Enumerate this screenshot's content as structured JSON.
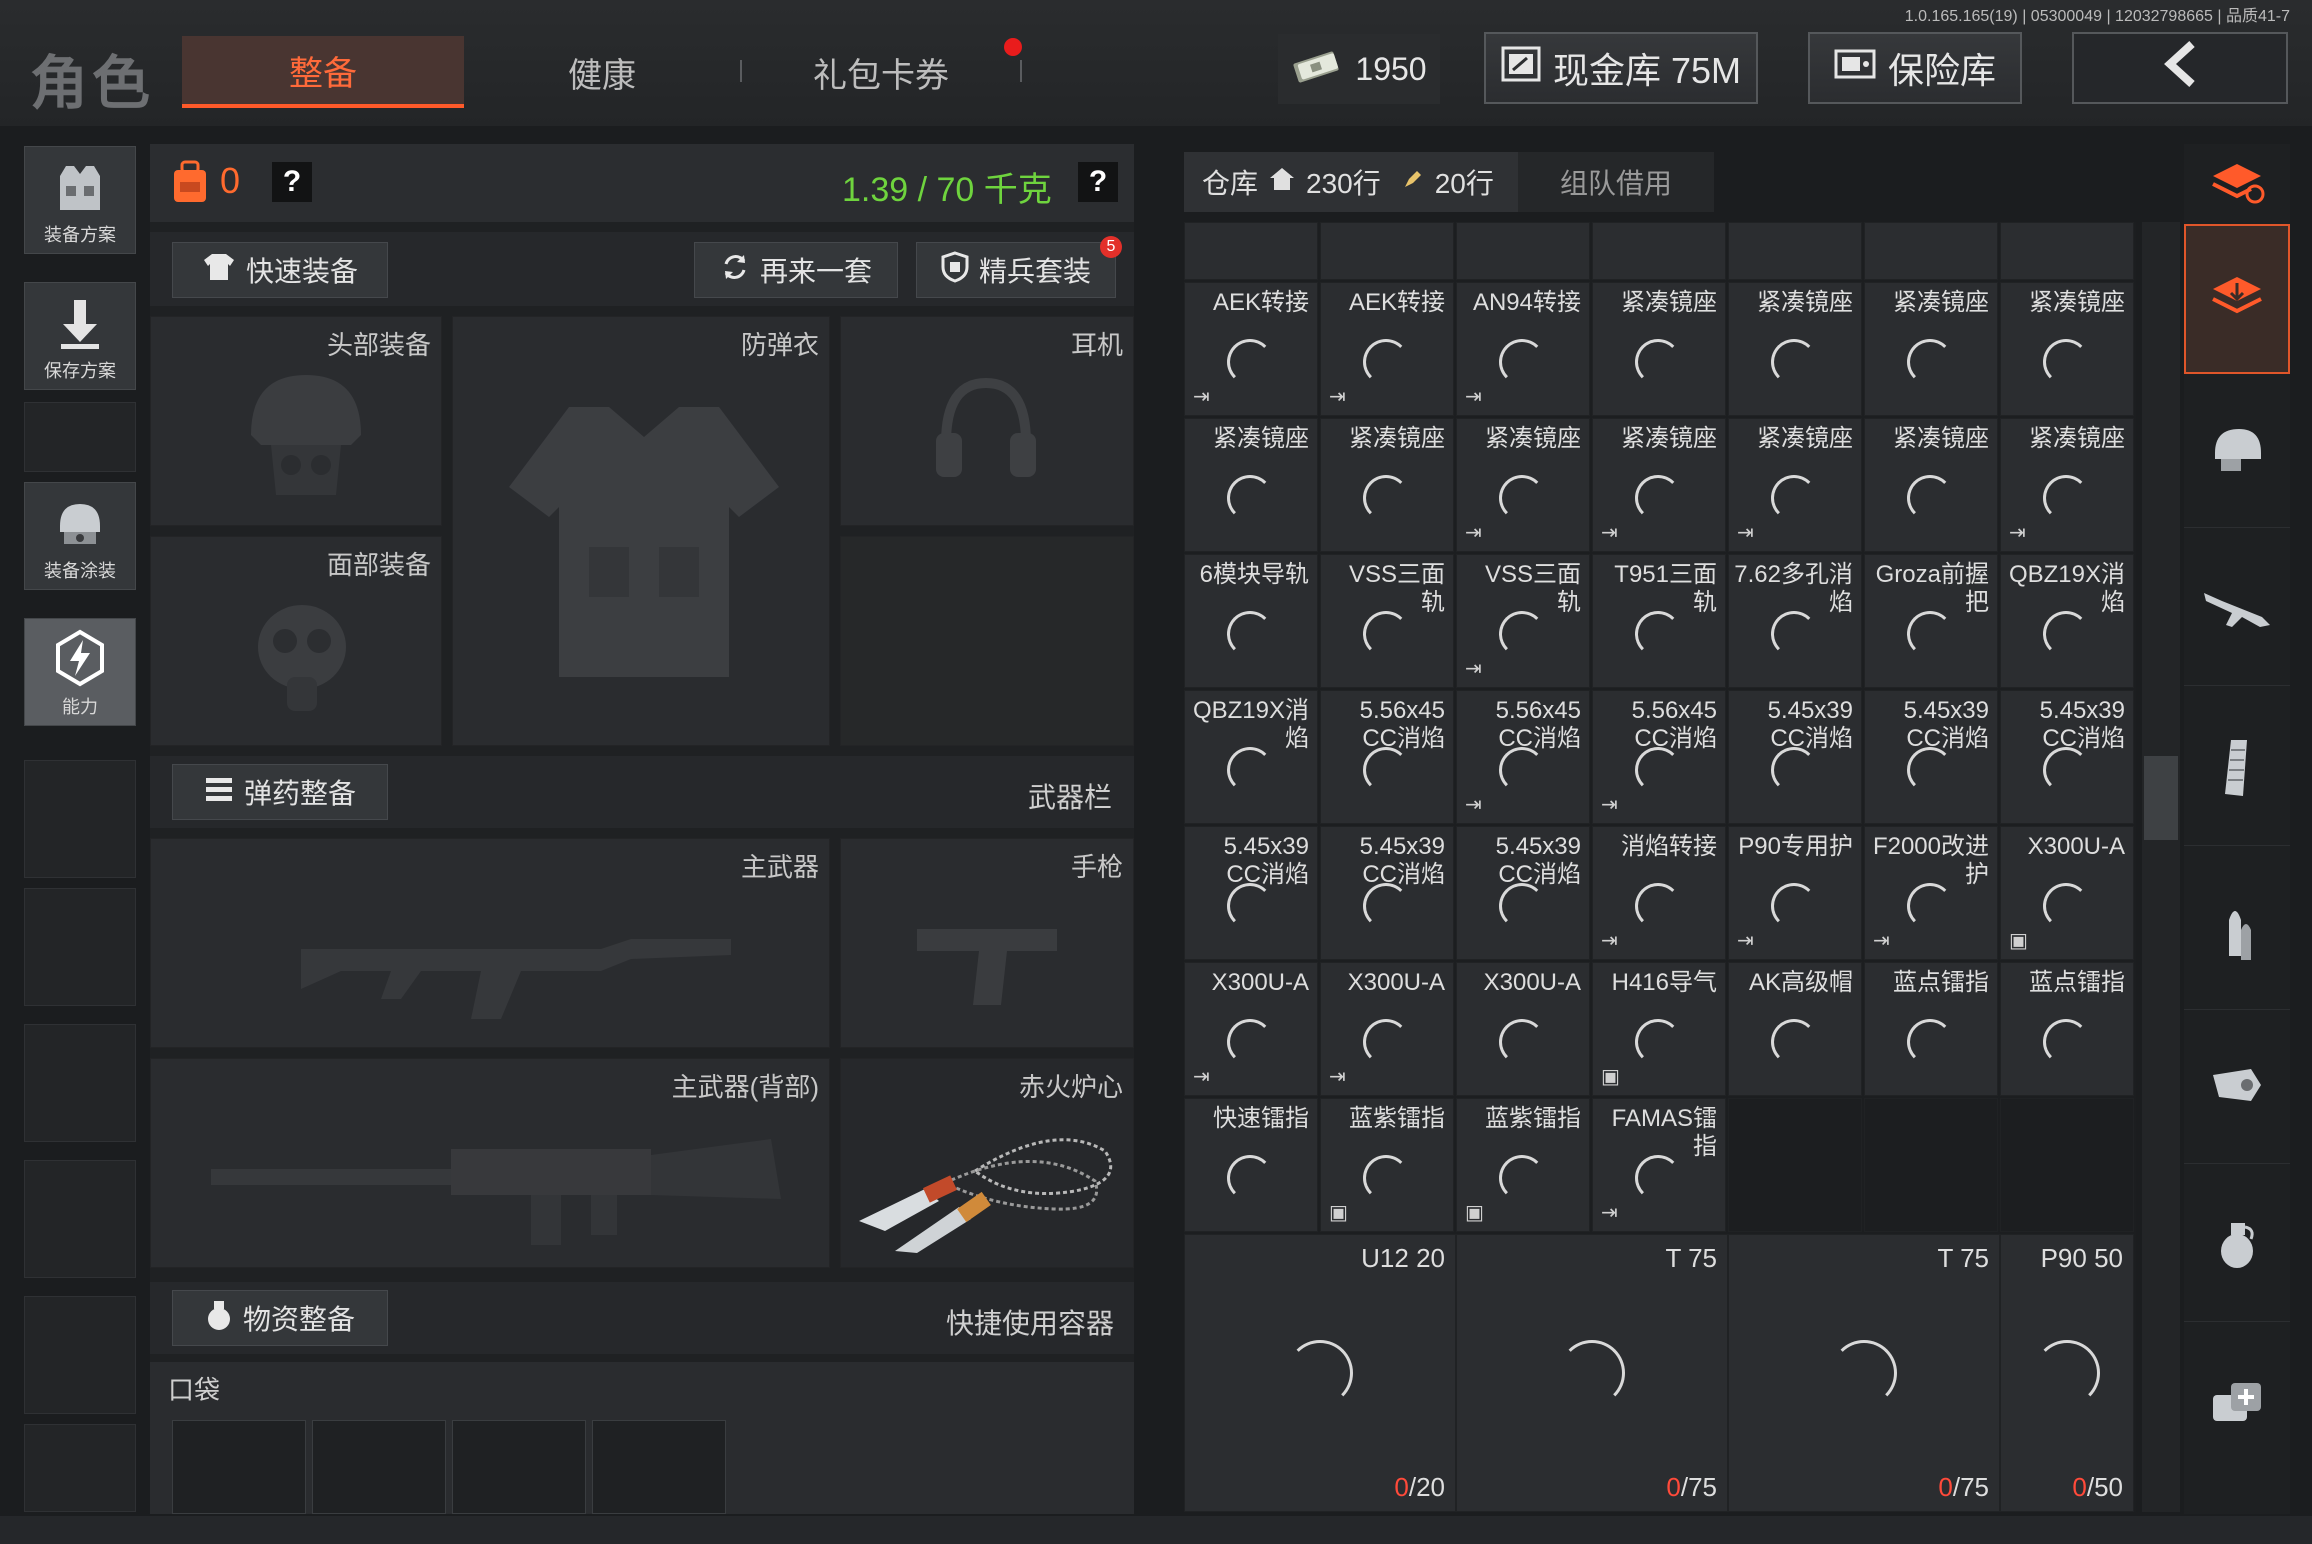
{
  "version": "1.0.165.165(19) | 05300049 | 12032798665 | 品质41-7",
  "header": {
    "title": "角色",
    "tabs": [
      {
        "label": "整备",
        "active": true
      },
      {
        "label": "健康",
        "active": false
      },
      {
        "label": "礼包卡券",
        "active": false
      }
    ],
    "currency": {
      "icon": "cash-bundle-icon",
      "value": "1950"
    },
    "cash_vault": "现金库 75M",
    "safe": "保险库"
  },
  "left_rail": [
    {
      "label": "装备方案",
      "icon": "vest-plan-icon"
    },
    {
      "label": "保存方案",
      "icon": "download-arrow-icon"
    },
    {
      "label": "装备涂装",
      "icon": "helmet-paint-icon"
    },
    {
      "label": "能力",
      "icon": "lightning-hexagon-icon",
      "active": true
    }
  ],
  "equip": {
    "bag_count": "0",
    "help": "?",
    "weight": "1.39 / 70 千克",
    "quick_equip": "快速装备",
    "again": "再来一套",
    "elite": "精兵套装",
    "elite_badge": "5",
    "slots": {
      "head": "头部装备",
      "armor": "防弹衣",
      "ear": "耳机",
      "face": "面部装备"
    },
    "ammo_section": "弹药整备",
    "weapon_bar": "武器栏",
    "weapons": {
      "primary": "主武器",
      "pistol": "手枪",
      "primary_back": "主武器(背部)",
      "melee": "赤火炉心"
    },
    "supply_section": "物资整备",
    "quick_container": "快捷使用容器",
    "pocket": "口袋"
  },
  "warehouse": {
    "tab": "仓库",
    "rows": "230行",
    "cols": "20行",
    "borrow": "组队借用",
    "items": [
      {
        "name": "AEK转接",
        "tag": "exit"
      },
      {
        "name": "AEK转接",
        "tag": "exit"
      },
      {
        "name": "AN94转接",
        "tag": "exit"
      },
      {
        "name": "紧凑镜座",
        "tag": ""
      },
      {
        "name": "紧凑镜座",
        "tag": ""
      },
      {
        "name": "紧凑镜座",
        "tag": ""
      },
      {
        "name": "紧凑镜座",
        "tag": ""
      },
      {
        "name": "紧凑镜座",
        "tag": ""
      },
      {
        "name": "紧凑镜座",
        "tag": ""
      },
      {
        "name": "紧凑镜座",
        "tag": "exit"
      },
      {
        "name": "紧凑镜座",
        "tag": "exit"
      },
      {
        "name": "紧凑镜座",
        "tag": "exit"
      },
      {
        "name": "紧凑镜座",
        "tag": ""
      },
      {
        "name": "紧凑镜座",
        "tag": "exit"
      },
      {
        "name": "6模块导轨",
        "tag": ""
      },
      {
        "name": "VSS三面轨",
        "tag": ""
      },
      {
        "name": "VSS三面轨",
        "tag": "exit"
      },
      {
        "name": "T951三面轨",
        "tag": ""
      },
      {
        "name": "7.62多孔消焰",
        "tag": ""
      },
      {
        "name": "Groza前握把",
        "tag": ""
      },
      {
        "name": "QBZ19X消焰",
        "tag": ""
      },
      {
        "name": "QBZ19X消焰",
        "tag": ""
      },
      {
        "name": "5.56x45 CC消焰",
        "tag": ""
      },
      {
        "name": "5.56x45 CC消焰",
        "tag": "exit"
      },
      {
        "name": "5.56x45 CC消焰",
        "tag": "exit"
      },
      {
        "name": "5.45x39 CC消焰",
        "tag": ""
      },
      {
        "name": "5.45x39 CC消焰",
        "tag": ""
      },
      {
        "name": "5.45x39 CC消焰",
        "tag": ""
      },
      {
        "name": "5.45x39 CC消焰",
        "tag": ""
      },
      {
        "name": "5.45x39 CC消焰",
        "tag": ""
      },
      {
        "name": "5.45x39 CC消焰",
        "tag": ""
      },
      {
        "name": "消焰转接",
        "tag": "exit"
      },
      {
        "name": "P90专用护",
        "tag": "exit"
      },
      {
        "name": "F2000改进护",
        "tag": "exit"
      },
      {
        "name": "X300U-A",
        "tag": "box"
      },
      {
        "name": "X300U-A",
        "tag": "exit"
      },
      {
        "name": "X300U-A",
        "tag": "exit"
      },
      {
        "name": "X300U-A",
        "tag": ""
      },
      {
        "name": "H416导气",
        "tag": "box"
      },
      {
        "name": "AK高级帽",
        "tag": ""
      },
      {
        "name": "蓝点镭指",
        "tag": ""
      },
      {
        "name": "蓝点镭指",
        "tag": ""
      },
      {
        "name": "快速镭指",
        "tag": ""
      },
      {
        "name": "蓝紫镭指",
        "tag": "box"
      },
      {
        "name": "蓝紫镭指",
        "tag": "box"
      },
      {
        "name": "FAMAS镭指",
        "tag": "exit"
      }
    ],
    "ammo": [
      {
        "name": "U12 20",
        "count": "0",
        "max": "/20"
      },
      {
        "name": "T 75",
        "count": "0",
        "max": "/75"
      },
      {
        "name": "T 75",
        "count": "0",
        "max": "/75"
      },
      {
        "name": "P90 50",
        "count": "0",
        "max": "/50"
      }
    ]
  },
  "categories": [
    "stack-refresh-icon",
    "stack-download-icon",
    "helmet-icon",
    "rifle-icon",
    "magazine-icon",
    "bullet-icon",
    "scope-icon",
    "grenade-icon",
    "medkit-icon"
  ],
  "colors": {
    "accent": "#ff5a2a",
    "weight_green": "#6fd43e",
    "count_red": "#ff4a3a"
  }
}
